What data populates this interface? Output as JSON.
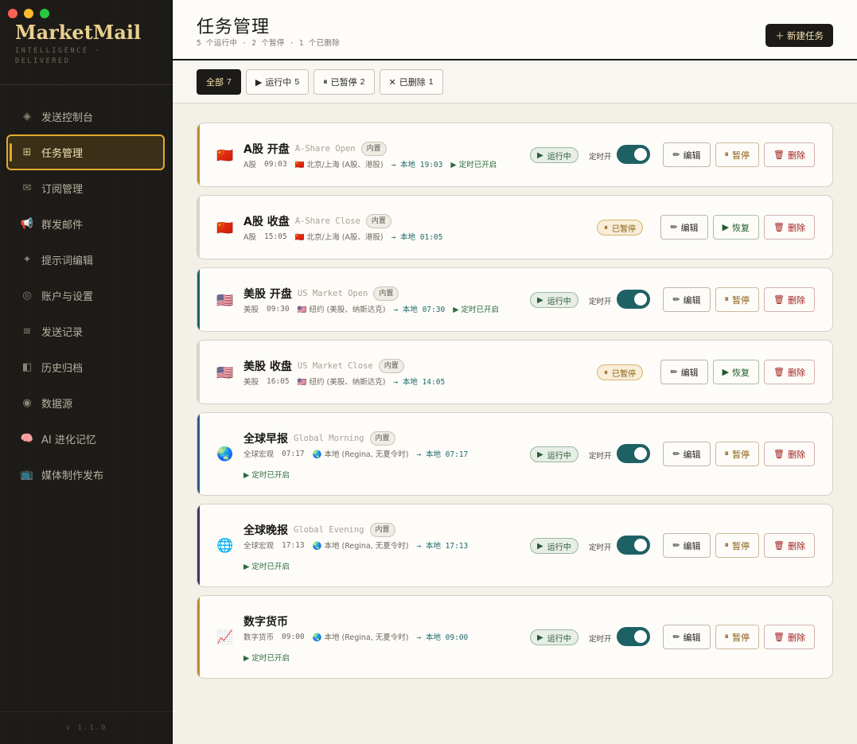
{
  "brand": {
    "name": "MarketMail",
    "tagline": "INTELLIGENCE · DELIVERED"
  },
  "nav": [
    {
      "label": "发送控制台",
      "icon": "◈",
      "active": false
    },
    {
      "label": "任务管理",
      "icon": "⊞",
      "active": true
    },
    {
      "label": "订阅管理",
      "icon": "✉",
      "active": false
    },
    {
      "label": "群发邮件",
      "icon": "📢",
      "active": false
    },
    {
      "label": "提示词编辑",
      "icon": "✦",
      "active": false
    },
    {
      "label": "账户与设置",
      "icon": "◎",
      "active": false
    },
    {
      "label": "发送记录",
      "icon": "≡",
      "active": false
    },
    {
      "label": "历史归档",
      "icon": "◧",
      "active": false
    },
    {
      "label": "数据源",
      "icon": "◉",
      "active": false
    },
    {
      "label": "AI 进化记忆",
      "icon": "🧠",
      "active": false
    },
    {
      "label": "媒体制作发布",
      "icon": "📺",
      "active": false
    }
  ],
  "version": "v 1.1.0",
  "header": {
    "title": "任务管理",
    "summary": "5 个运行中 · 2 个暂停 · 1 个已删除",
    "new_button": "＋ 新建任务"
  },
  "filters": [
    {
      "label": "全部",
      "count": "7",
      "icon": ""
    },
    {
      "label": "运行中",
      "count": "5",
      "icon": "▶"
    },
    {
      "label": "已暂停",
      "count": "2",
      "icon": "⏸"
    },
    {
      "label": "已删除",
      "count": "1",
      "icon": "✕"
    }
  ],
  "labels": {
    "builtin": "内置",
    "running": "运行中",
    "paused": "已暂停",
    "schedule_on": "定时开",
    "schedule_enabled": "定时已开启",
    "edit": "编辑",
    "pause": "暂停",
    "resume": "恢复",
    "delete": "删除"
  },
  "tasks": [
    {
      "name": "A股 开盘",
      "name_en": "A-Share Open",
      "flag": "🇨🇳",
      "category": "A股",
      "time": "09:03",
      "zone_flag": "🇨🇳",
      "zone": "北京/上海 (A股、港股)",
      "local": "→ 本地 19:03",
      "status": "running",
      "accent": "#b8912a",
      "sched_inline": true
    },
    {
      "name": "A股 收盘",
      "name_en": "A-Share Close",
      "flag": "🇨🇳",
      "category": "A股",
      "time": "15:05",
      "zone_flag": "🇨🇳",
      "zone": "北京/上海 (A股、港股)",
      "local": "→ 本地 01:05",
      "status": "paused",
      "accent": "#d9d4c8",
      "sched_inline": false
    },
    {
      "name": "美股 开盘",
      "name_en": "US Market Open",
      "flag": "🇺🇸",
      "category": "美股",
      "time": "09:30",
      "zone_flag": "🇺🇸",
      "zone": "纽约 (美股、纳斯达克)",
      "local": "→ 本地 07:30",
      "status": "running",
      "accent": "#1e6164",
      "sched_inline": true
    },
    {
      "name": "美股 收盘",
      "name_en": "US Market Close",
      "flag": "🇺🇸",
      "category": "美股",
      "time": "16:05",
      "zone_flag": "🇺🇸",
      "zone": "纽约 (美股、纳斯达克)",
      "local": "→ 本地 14:05",
      "status": "paused",
      "accent": "#d9d4c8",
      "sched_inline": false
    },
    {
      "name": "全球早报",
      "name_en": "Global Morning",
      "flag": "🌏",
      "category": "全球宏观",
      "time": "07:17",
      "zone_flag": "🌏",
      "zone": "本地 (Regina, 无夏令时)",
      "local": "→ 本地 07:17",
      "status": "running",
      "accent": "#2f5b8a",
      "sched_inline": false
    },
    {
      "name": "全球晚报",
      "name_en": "Global Evening",
      "flag": "🌐",
      "category": "全球宏观",
      "time": "17:13",
      "zone_flag": "🌏",
      "zone": "本地 (Regina, 无夏令时)",
      "local": "→ 本地 17:13",
      "status": "running",
      "accent": "#4b2f6b",
      "sched_inline": false
    },
    {
      "name": "数字货币",
      "name_en": "",
      "flag": "📈",
      "category": "数字货币",
      "time": "09:00",
      "zone_flag": "🌏",
      "zone": "本地 (Regina, 无夏令时)",
      "local": "→ 本地 09:00",
      "status": "running",
      "accent": "#b8912a",
      "sched_inline": false
    }
  ]
}
